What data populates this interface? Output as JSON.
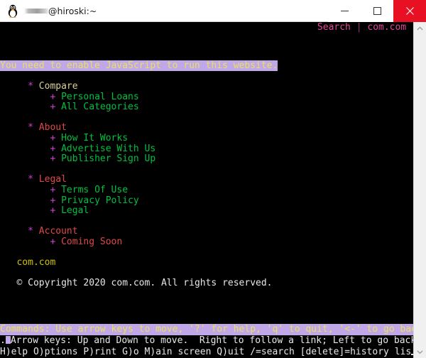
{
  "window": {
    "title": "@hiroski:~",
    "icon": "tux-penguin-icon",
    "redacted_username": true,
    "controls": {
      "minimize_label": "–",
      "maximize_label": "□",
      "close_label": "✕"
    }
  },
  "colors": {
    "terminal_bg": "#000000",
    "link_green": "#00c040",
    "bullet_magenta": "#d040d0",
    "heading_red": "#e04848",
    "current_link_bg": "#c0a8e8",
    "current_link_fg": "#e8e060",
    "brand_yellow": "#d0c000",
    "pink_link": "#e04898",
    "close_button": "#e81123"
  },
  "terminal": {
    "top_nav": {
      "search_label": "Search",
      "separator": "|",
      "site_label": "com.com"
    },
    "js_notice": "You need to enable JavaScript to run this website.",
    "sections": [
      {
        "bullet": "*",
        "heading": "Compare",
        "heading_style": "current",
        "items": [
          {
            "marker": "+",
            "label": "Personal Loans",
            "style": "link"
          },
          {
            "marker": "+",
            "label": "All Categories",
            "style": "link"
          }
        ]
      },
      {
        "bullet": "*",
        "heading": "About",
        "heading_style": "heading",
        "items": [
          {
            "marker": "+",
            "label": "How It Works",
            "style": "link"
          },
          {
            "marker": "+",
            "label": "Advertise With Us",
            "style": "link"
          },
          {
            "marker": "+",
            "label": "Publisher Sign Up",
            "style": "link"
          }
        ]
      },
      {
        "bullet": "*",
        "heading": "Legal",
        "heading_style": "heading",
        "items": [
          {
            "marker": "+",
            "label": "Terms Of Use",
            "style": "link"
          },
          {
            "marker": "+",
            "label": "Privacy Policy",
            "style": "link"
          },
          {
            "marker": "+",
            "label": "Legal",
            "style": "link"
          }
        ]
      },
      {
        "bullet": "*",
        "heading": "Account",
        "heading_style": "heading",
        "items": [
          {
            "marker": "+",
            "label": "Coming Soon",
            "style": "plain"
          }
        ]
      }
    ],
    "brand": "com.com",
    "copyright": "© Copyright 2020 com.com. All rights reserved.",
    "status": {
      "commands_line": "Commands: Use arrow keys to move, '?' for help, 'q' to quit, '<-' to go back",
      "commands_tail": ".",
      "arrow_keys_line": "Arrow keys: Up and Down to move.  Right to follow a link; Left to go back.",
      "keys_line": "H)elp O)ptions P)rint G)o M)ain screen Q)uit /=search [delete]=history lis"
    }
  },
  "scrollbar": {
    "up_arrow": "chevron-up",
    "down_arrow": "chevron-down"
  }
}
